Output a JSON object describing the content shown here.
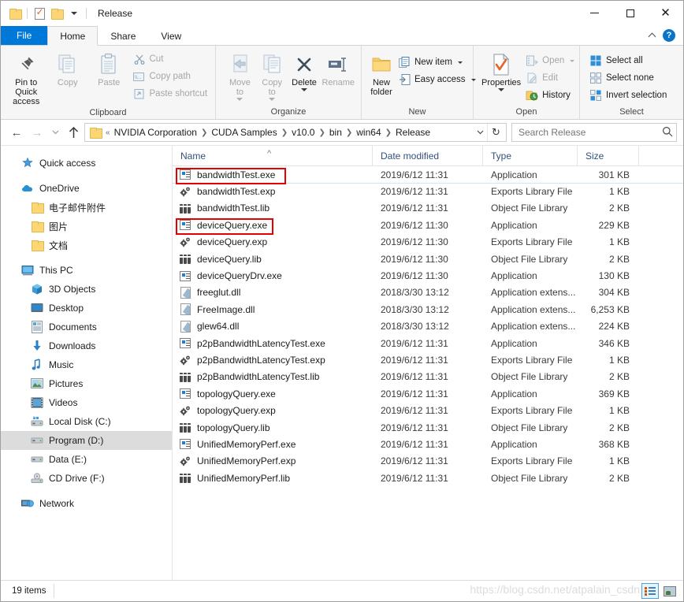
{
  "window": {
    "title": "Release",
    "quick_access": [
      "folder-icon",
      "properties-icon",
      "new-folder-icon",
      "customize-dropdown"
    ],
    "controls": {
      "minimize": "—",
      "maximize": "□",
      "close": "✕"
    }
  },
  "tabs": [
    {
      "label": "File",
      "kind": "file"
    },
    {
      "label": "Home",
      "kind": "active"
    },
    {
      "label": "Share",
      "kind": "normal"
    },
    {
      "label": "View",
      "kind": "normal"
    }
  ],
  "tabstrip_right": {
    "collapse": "chevron-up-icon",
    "help": "?"
  },
  "ribbon": {
    "groups": [
      {
        "label": "Clipboard",
        "big": [
          {
            "label_line1": "Pin to Quick",
            "label_line2": "access",
            "icon": "pin-icon",
            "disabled": false
          },
          {
            "label_line1": "Copy",
            "label_line2": "",
            "icon": "copy-icon",
            "disabled": true
          },
          {
            "label_line1": "Paste",
            "label_line2": "",
            "icon": "paste-icon",
            "disabled": true
          }
        ],
        "small": [
          {
            "label": "Cut",
            "icon": "scissors-icon",
            "disabled": true
          },
          {
            "label": "Copy path",
            "icon": "copy-path-icon",
            "disabled": true
          },
          {
            "label": "Paste shortcut",
            "icon": "paste-shortcut-icon",
            "disabled": true
          }
        ]
      },
      {
        "label": "Organize",
        "big": [
          {
            "label_line1": "Move",
            "label_line2": "to",
            "icon": "move-to-icon",
            "disabled": true,
            "caret": true
          },
          {
            "label_line1": "Copy",
            "label_line2": "to",
            "icon": "copy-to-icon",
            "disabled": true,
            "caret": true
          },
          {
            "label_line1": "Delete",
            "label_line2": "",
            "icon": "delete-icon",
            "disabled": false,
            "caret": true
          },
          {
            "label_line1": "Rename",
            "label_line2": "",
            "icon": "rename-icon",
            "disabled": true
          }
        ],
        "small": []
      },
      {
        "label": "New",
        "big": [
          {
            "label_line1": "New",
            "label_line2": "folder",
            "icon": "new-folder-icon",
            "disabled": false
          }
        ],
        "small": [
          {
            "label": "New item",
            "icon": "new-item-icon",
            "disabled": false,
            "caret": true
          },
          {
            "label": "Easy access",
            "icon": "easy-access-icon",
            "disabled": false,
            "caret": true
          }
        ]
      },
      {
        "label": "Open",
        "big": [
          {
            "label_line1": "Properties",
            "label_line2": "",
            "icon": "properties-icon",
            "disabled": false,
            "caret": true
          }
        ],
        "small": [
          {
            "label": "Open",
            "icon": "open-icon",
            "disabled": true,
            "caret": true
          },
          {
            "label": "Edit",
            "icon": "edit-icon",
            "disabled": true
          },
          {
            "label": "History",
            "icon": "history-icon",
            "disabled": false
          }
        ]
      },
      {
        "label": "Select",
        "big": [],
        "small": [
          {
            "label": "Select all",
            "icon": "select-all-icon",
            "disabled": false
          },
          {
            "label": "Select none",
            "icon": "select-none-icon",
            "disabled": false
          },
          {
            "label": "Invert selection",
            "icon": "invert-selection-icon",
            "disabled": false
          }
        ]
      }
    ]
  },
  "address": {
    "back": "←",
    "forward": "→",
    "recent": "⌄",
    "up": "↑",
    "breadcrumb": [
      "NVIDIA Corporation",
      "CUDA Samples",
      "v10.0",
      "bin",
      "win64",
      "Release"
    ],
    "breadcrumb_prefix": "«",
    "refresh": "↻",
    "search_placeholder": "Search Release",
    "search_value": ""
  },
  "sidebar": {
    "items": [
      {
        "label": "Quick access",
        "icon": "star-pin-icon",
        "level": 1,
        "selected": false,
        "gap_before": false
      },
      {
        "label": "OneDrive",
        "icon": "onedrive-cloud-icon",
        "level": 1,
        "selected": false,
        "gap_before": true
      },
      {
        "label": "电子邮件附件",
        "icon": "folder-icon",
        "level": 2,
        "selected": false,
        "gap_before": false
      },
      {
        "label": "图片",
        "icon": "folder-icon",
        "level": 2,
        "selected": false,
        "gap_before": false
      },
      {
        "label": "文档",
        "icon": "folder-icon",
        "level": 2,
        "selected": false,
        "gap_before": false
      },
      {
        "label": "This PC",
        "icon": "pc-monitor-icon",
        "level": 1,
        "selected": false,
        "gap_before": true
      },
      {
        "label": "3D Objects",
        "icon": "3d-objects-icon",
        "level": 2,
        "selected": false,
        "gap_before": false
      },
      {
        "label": "Desktop",
        "icon": "desktop-icon",
        "level": 2,
        "selected": false,
        "gap_before": false
      },
      {
        "label": "Documents",
        "icon": "documents-icon",
        "level": 2,
        "selected": false,
        "gap_before": false
      },
      {
        "label": "Downloads",
        "icon": "downloads-arrow-icon",
        "level": 2,
        "selected": false,
        "gap_before": false
      },
      {
        "label": "Music",
        "icon": "music-note-icon",
        "level": 2,
        "selected": false,
        "gap_before": false
      },
      {
        "label": "Pictures",
        "icon": "pictures-icon",
        "level": 2,
        "selected": false,
        "gap_before": false
      },
      {
        "label": "Videos",
        "icon": "videos-film-icon",
        "level": 2,
        "selected": false,
        "gap_before": false
      },
      {
        "label": "Local Disk (C:)",
        "icon": "local-disk-icon",
        "level": 2,
        "selected": false,
        "gap_before": false
      },
      {
        "label": "Program (D:)",
        "icon": "drive-icon",
        "level": 2,
        "selected": true,
        "gap_before": false
      },
      {
        "label": "Data (E:)",
        "icon": "drive-icon",
        "level": 2,
        "selected": false,
        "gap_before": false
      },
      {
        "label": "CD Drive (F:)",
        "icon": "cd-drive-icon",
        "level": 2,
        "selected": false,
        "gap_before": false
      },
      {
        "label": "Network",
        "icon": "network-icon",
        "level": 1,
        "selected": false,
        "gap_before": true
      }
    ]
  },
  "filelist": {
    "columns": [
      {
        "key": "name",
        "label": "Name",
        "sorted": "asc"
      },
      {
        "key": "date",
        "label": "Date modified",
        "sorted": ""
      },
      {
        "key": "type",
        "label": "Type",
        "sorted": ""
      },
      {
        "key": "size",
        "label": "Size",
        "sorted": ""
      }
    ],
    "rows": [
      {
        "name": "bandwidthTest.exe",
        "date": "2019/6/12 11:31",
        "type": "Application",
        "size": "301 KB",
        "icon": "exe-icon",
        "selected": true,
        "highlight": true
      },
      {
        "name": "bandwidthTest.exp",
        "date": "2019/6/12 11:31",
        "type": "Exports Library File",
        "size": "1 KB",
        "icon": "exp-icon",
        "selected": false,
        "highlight": false
      },
      {
        "name": "bandwidthTest.lib",
        "date": "2019/6/12 11:31",
        "type": "Object File Library",
        "size": "2 KB",
        "icon": "lib-icon",
        "selected": false,
        "highlight": false
      },
      {
        "name": "deviceQuery.exe",
        "date": "2019/6/12 11:30",
        "type": "Application",
        "size": "229 KB",
        "icon": "exe-icon",
        "selected": false,
        "highlight": true
      },
      {
        "name": "deviceQuery.exp",
        "date": "2019/6/12 11:30",
        "type": "Exports Library File",
        "size": "1 KB",
        "icon": "exp-icon",
        "selected": false,
        "highlight": false
      },
      {
        "name": "deviceQuery.lib",
        "date": "2019/6/12 11:30",
        "type": "Object File Library",
        "size": "2 KB",
        "icon": "lib-icon",
        "selected": false,
        "highlight": false
      },
      {
        "name": "deviceQueryDrv.exe",
        "date": "2019/6/12 11:30",
        "type": "Application",
        "size": "130 KB",
        "icon": "exe-icon",
        "selected": false,
        "highlight": false
      },
      {
        "name": "freeglut.dll",
        "date": "2018/3/30 13:12",
        "type": "Application extens...",
        "size": "304 KB",
        "icon": "dll-icon",
        "selected": false,
        "highlight": false
      },
      {
        "name": "FreeImage.dll",
        "date": "2018/3/30 13:12",
        "type": "Application extens...",
        "size": "6,253 KB",
        "icon": "dll-icon",
        "selected": false,
        "highlight": false
      },
      {
        "name": "glew64.dll",
        "date": "2018/3/30 13:12",
        "type": "Application extens...",
        "size": "224 KB",
        "icon": "dll-icon",
        "selected": false,
        "highlight": false
      },
      {
        "name": "p2pBandwidthLatencyTest.exe",
        "date": "2019/6/12 11:31",
        "type": "Application",
        "size": "346 KB",
        "icon": "exe-icon",
        "selected": false,
        "highlight": false
      },
      {
        "name": "p2pBandwidthLatencyTest.exp",
        "date": "2019/6/12 11:31",
        "type": "Exports Library File",
        "size": "1 KB",
        "icon": "exp-icon",
        "selected": false,
        "highlight": false
      },
      {
        "name": "p2pBandwidthLatencyTest.lib",
        "date": "2019/6/12 11:31",
        "type": "Object File Library",
        "size": "2 KB",
        "icon": "lib-icon",
        "selected": false,
        "highlight": false
      },
      {
        "name": "topologyQuery.exe",
        "date": "2019/6/12 11:31",
        "type": "Application",
        "size": "369 KB",
        "icon": "exe-icon",
        "selected": false,
        "highlight": false
      },
      {
        "name": "topologyQuery.exp",
        "date": "2019/6/12 11:31",
        "type": "Exports Library File",
        "size": "1 KB",
        "icon": "exp-icon",
        "selected": false,
        "highlight": false
      },
      {
        "name": "topologyQuery.lib",
        "date": "2019/6/12 11:31",
        "type": "Object File Library",
        "size": "2 KB",
        "icon": "lib-icon",
        "selected": false,
        "highlight": false
      },
      {
        "name": "UnifiedMemoryPerf.exe",
        "date": "2019/6/12 11:31",
        "type": "Application",
        "size": "368 KB",
        "icon": "exe-icon",
        "selected": false,
        "highlight": false
      },
      {
        "name": "UnifiedMemoryPerf.exp",
        "date": "2019/6/12 11:31",
        "type": "Exports Library File",
        "size": "1 KB",
        "icon": "exp-icon",
        "selected": false,
        "highlight": false
      },
      {
        "name": "UnifiedMemoryPerf.lib",
        "date": "2019/6/12 11:31",
        "type": "Object File Library",
        "size": "2 KB",
        "icon": "lib-icon",
        "selected": false,
        "highlight": false
      }
    ]
  },
  "statusbar": {
    "item_count": "19 items",
    "watermark": "https://blog.csdn.net/atpalain_csdn",
    "views": [
      {
        "name": "details-view",
        "active": true
      },
      {
        "name": "large-icons-view",
        "active": false
      }
    ]
  },
  "colors": {
    "accent": "#0078d7",
    "annotation_red": "#e60000",
    "header_text": "#33517a",
    "selected_row": "#cce8f4"
  }
}
